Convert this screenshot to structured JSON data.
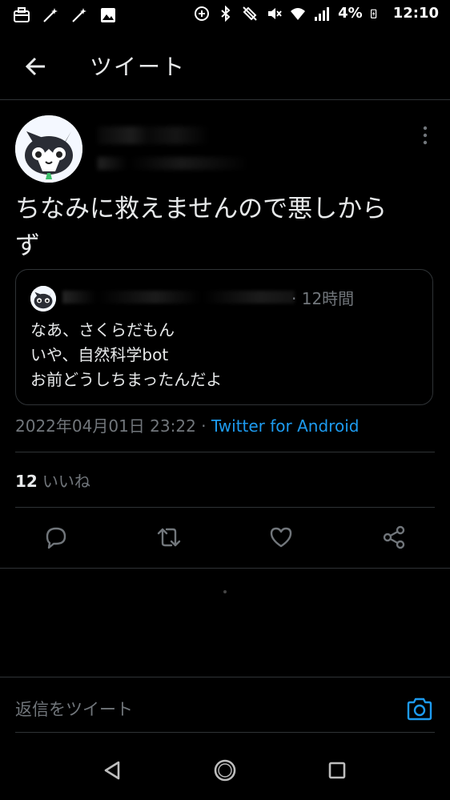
{
  "status_bar": {
    "battery": "4%",
    "time": "12:10"
  },
  "header": {
    "title": "ツイート"
  },
  "tweet": {
    "text_line1": "ちなみに救えませんので悪しから",
    "text_line2": "ず",
    "timestamp": "2022年04月01日 23:22",
    "separator": " · ",
    "client": "Twitter for Android",
    "like_count": "12",
    "like_label": "いいね"
  },
  "quoted_tweet": {
    "time": "· 12時間",
    "lines": [
      "なあ、さくらだもん",
      "いや、自然科学bot",
      "お前どうしちまったんだよ"
    ]
  },
  "composer": {
    "placeholder": "返信をツイート"
  },
  "colors": {
    "background": "#000000",
    "text": "#e7e9ea",
    "muted": "#71767b",
    "accent": "#1d9bf0",
    "border": "#2f3336"
  },
  "icons": {
    "status_left": [
      "briefcase-icon",
      "magic-wand-icon",
      "magic-wand-icon",
      "image-icon"
    ],
    "status_right": [
      "data-saver-icon",
      "bluetooth-icon",
      "nfc-icon",
      "mute-icon",
      "wifi-icon",
      "signal-icon",
      "battery-charging-icon"
    ],
    "actions": [
      "reply-icon",
      "retweet-icon",
      "like-icon",
      "share-icon"
    ]
  }
}
